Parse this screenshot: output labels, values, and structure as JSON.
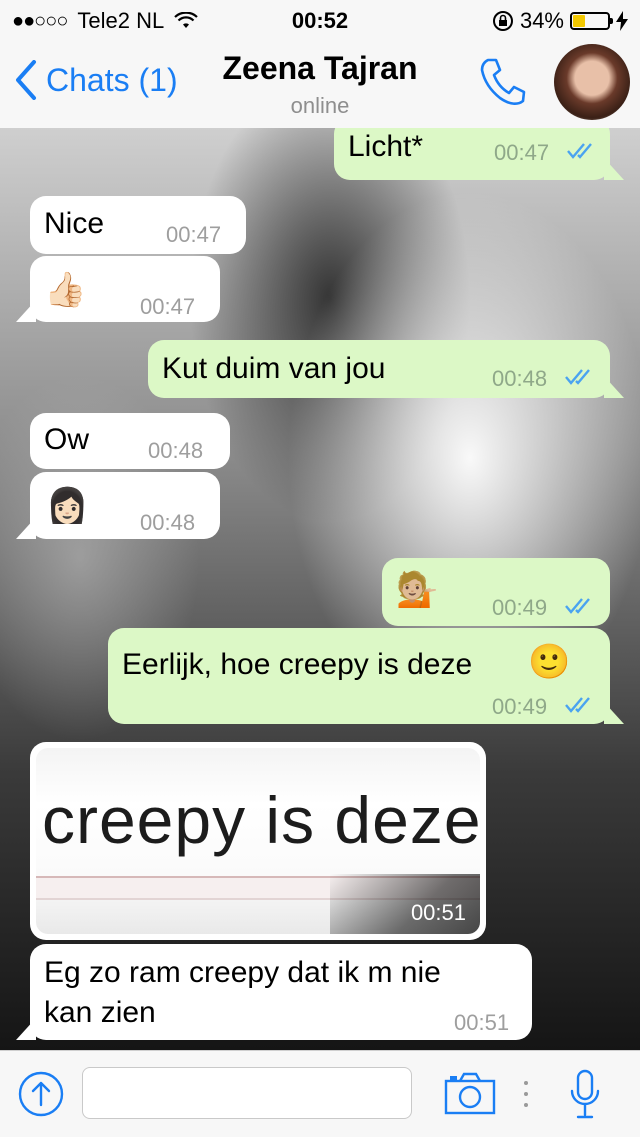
{
  "status_bar": {
    "carrier": "Tele2 NL",
    "signal_dots": "●●○○○",
    "time": "00:52",
    "battery": "34%",
    "battery_level": 0.34
  },
  "header": {
    "back_label": "Chats (1)",
    "contact_name": "Zeena Tajran",
    "presence": "online"
  },
  "messages": [
    {
      "dir": "out",
      "text": "Licht*",
      "time": "00:47",
      "read": true
    },
    {
      "dir": "in",
      "text": "Nice",
      "time": "00:47"
    },
    {
      "dir": "in",
      "emoji": "👍🏻",
      "time": "00:47"
    },
    {
      "dir": "out",
      "text": "Kut duim van jou",
      "time": "00:48",
      "read": true
    },
    {
      "dir": "in",
      "text": "Ow",
      "time": "00:48"
    },
    {
      "dir": "in",
      "emoji": "👩🏻",
      "time": "00:48"
    },
    {
      "dir": "out",
      "emoji": "💁🏼",
      "time": "00:49",
      "read": true
    },
    {
      "dir": "out",
      "text": "Eerlijk, hoe creepy is deze",
      "emoji": "🙂",
      "time": "00:49",
      "read": true
    },
    {
      "dir": "in",
      "image_text": "creepy is deze",
      "time": "00:51"
    },
    {
      "dir": "in",
      "text_line1": "Eg zo ram creepy dat ik m nie",
      "text_line2": "kan zien",
      "time": "00:51"
    }
  ],
  "input": {
    "placeholder": ""
  },
  "colors": {
    "accent": "#1a7ef4",
    "outgoing_bubble": "#dcf8c6",
    "incoming_bubble": "#ffffff",
    "read_ticks": "#4aa3f0"
  }
}
